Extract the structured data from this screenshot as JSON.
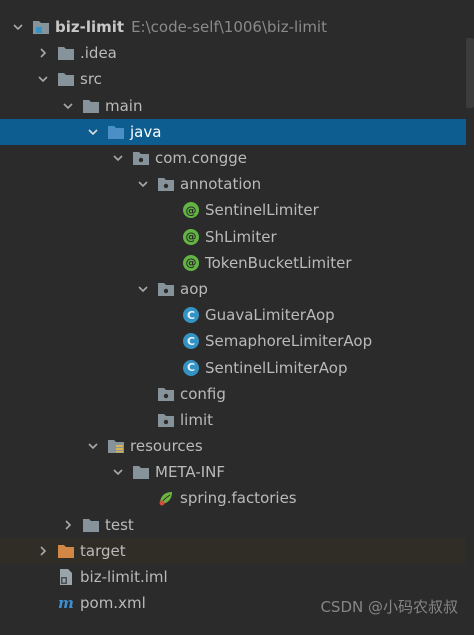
{
  "tree": {
    "project": {
      "label": "biz-limit",
      "path": "E:\\code-self\\1006\\biz-limit"
    },
    "idea": {
      "label": ".idea"
    },
    "src": {
      "label": "src"
    },
    "main": {
      "label": "main"
    },
    "java": {
      "label": "java"
    },
    "package": {
      "label": "com.congge"
    },
    "annotation": {
      "label": "annotation"
    },
    "sentinel_limiter": {
      "label": "SentinelLimiter"
    },
    "sh_limiter": {
      "label": "ShLimiter"
    },
    "token_bucket_limiter": {
      "label": "TokenBucketLimiter"
    },
    "aop": {
      "label": "aop"
    },
    "guava_limiter_aop": {
      "label": "GuavaLimiterAop"
    },
    "semaphore_limiter_aop": {
      "label": "SemaphoreLimiterAop"
    },
    "sentinel_limiter_aop": {
      "label": "SentinelLimiterAop"
    },
    "config": {
      "label": "config"
    },
    "limit": {
      "label": "limit"
    },
    "resources": {
      "label": "resources"
    },
    "meta_inf": {
      "label": "META-INF"
    },
    "spring_factories": {
      "label": "spring.factories"
    },
    "test": {
      "label": "test"
    },
    "target": {
      "label": "target"
    },
    "iml": {
      "label": "biz-limit.iml"
    },
    "pom": {
      "label": "pom.xml"
    }
  },
  "badges": {
    "annotation": "@",
    "class": "C"
  },
  "watermark": "CSDN @小码农叔叔",
  "colors": {
    "background": "#2b2b2b",
    "selection": "#0d5d91",
    "folder": "#87939a",
    "source_folder": "#4a8fc7",
    "excluded_folder": "#d08844",
    "annotation_badge": "#62b543",
    "class_badge": "#3592c4"
  }
}
